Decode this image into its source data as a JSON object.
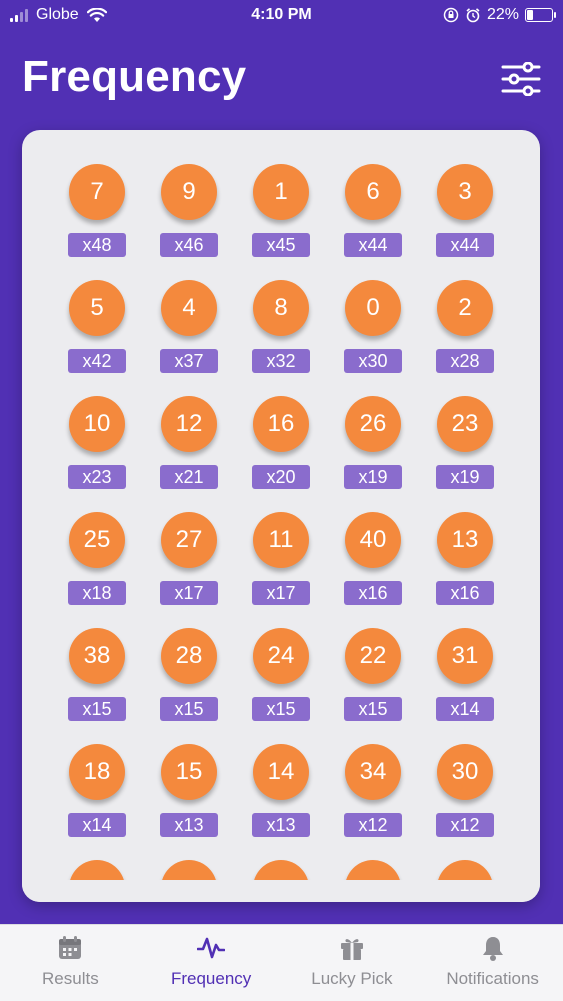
{
  "status_bar": {
    "carrier": "Globe",
    "time": "4:10 PM",
    "battery_percent": "22%",
    "battery_level": 0.22
  },
  "header": {
    "title": "Frequency",
    "filter_icon": "sliders-icon"
  },
  "frequency": [
    {
      "number": "7",
      "count": "x48"
    },
    {
      "number": "9",
      "count": "x46"
    },
    {
      "number": "1",
      "count": "x45"
    },
    {
      "number": "6",
      "count": "x44"
    },
    {
      "number": "3",
      "count": "x44"
    },
    {
      "number": "5",
      "count": "x42"
    },
    {
      "number": "4",
      "count": "x37"
    },
    {
      "number": "8",
      "count": "x32"
    },
    {
      "number": "0",
      "count": "x30"
    },
    {
      "number": "2",
      "count": "x28"
    },
    {
      "number": "10",
      "count": "x23"
    },
    {
      "number": "12",
      "count": "x21"
    },
    {
      "number": "16",
      "count": "x20"
    },
    {
      "number": "26",
      "count": "x19"
    },
    {
      "number": "23",
      "count": "x19"
    },
    {
      "number": "25",
      "count": "x18"
    },
    {
      "number": "27",
      "count": "x17"
    },
    {
      "number": "11",
      "count": "x17"
    },
    {
      "number": "40",
      "count": "x16"
    },
    {
      "number": "13",
      "count": "x16"
    },
    {
      "number": "38",
      "count": "x15"
    },
    {
      "number": "28",
      "count": "x15"
    },
    {
      "number": "24",
      "count": "x15"
    },
    {
      "number": "22",
      "count": "x15"
    },
    {
      "number": "31",
      "count": "x14"
    },
    {
      "number": "18",
      "count": "x14"
    },
    {
      "number": "15",
      "count": "x13"
    },
    {
      "number": "14",
      "count": "x13"
    },
    {
      "number": "34",
      "count": "x12"
    },
    {
      "number": "30",
      "count": "x12"
    },
    {
      "number": "",
      "count": ""
    },
    {
      "number": "",
      "count": ""
    },
    {
      "number": "",
      "count": ""
    },
    {
      "number": "",
      "count": ""
    },
    {
      "number": "",
      "count": ""
    }
  ],
  "tabs": [
    {
      "label": "Results",
      "icon": "calendar-icon",
      "active": false
    },
    {
      "label": "Frequency",
      "icon": "pulse-icon",
      "active": true
    },
    {
      "label": "Lucky Pick",
      "icon": "gift-icon",
      "active": false
    },
    {
      "label": "Notifications",
      "icon": "bell-icon",
      "active": false
    }
  ],
  "colors": {
    "background": "#5130b4",
    "ball": "#f4893d",
    "count_badge": "#8a6ccd",
    "tab_active": "#5130b4",
    "tab_inactive": "#8e8e93"
  }
}
